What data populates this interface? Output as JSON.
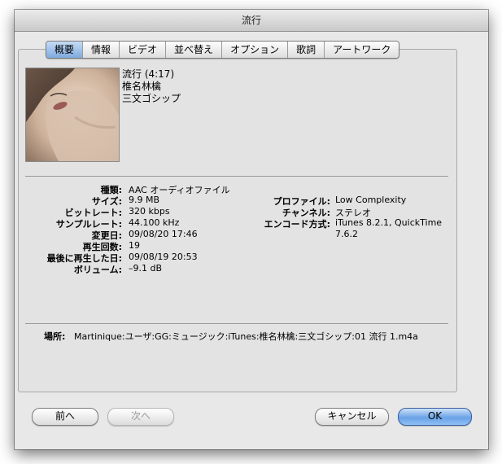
{
  "window": {
    "title": "流行"
  },
  "tabs": [
    "概要",
    "情報",
    "ビデオ",
    "並べ替え",
    "オプション",
    "歌詞",
    "アートワーク"
  ],
  "track": {
    "title_line": "流行 (4:17)",
    "artist": "椎名林檎",
    "album": "三文ゴシップ"
  },
  "left_fields": [
    {
      "label": "種類:",
      "value": "AAC オーディオファイル"
    },
    {
      "label": "サイズ:",
      "value": "9.9 MB"
    },
    {
      "label": "ビットレート:",
      "value": "320 kbps"
    },
    {
      "label": "サンプルレート:",
      "value": "44.100 kHz"
    },
    {
      "label": "変更日:",
      "value": "09/08/20 17:46"
    },
    {
      "label": "再生回数:",
      "value": "19"
    },
    {
      "label": "最後に再生した日:",
      "value": "09/08/19 20:53"
    },
    {
      "label": "ボリューム:",
      "value": "–9.1 dB"
    }
  ],
  "right_fields": [
    {
      "label": "プロファイル:",
      "value": "Low Complexity"
    },
    {
      "label": "チャンネル:",
      "value": "ステレオ"
    },
    {
      "label": "エンコード方式:",
      "value": "iTunes 8.2.1, QuickTime",
      "value2": "7.6.2"
    }
  ],
  "location": {
    "label": "場所:",
    "value": "Martinique:ユーザ:GG:ミュージック:iTunes:椎名林檎:三文ゴシップ:01 流行 1.m4a"
  },
  "buttons": {
    "prev": "前へ",
    "next": "次へ",
    "cancel": "キャンセル",
    "ok": "OK"
  }
}
